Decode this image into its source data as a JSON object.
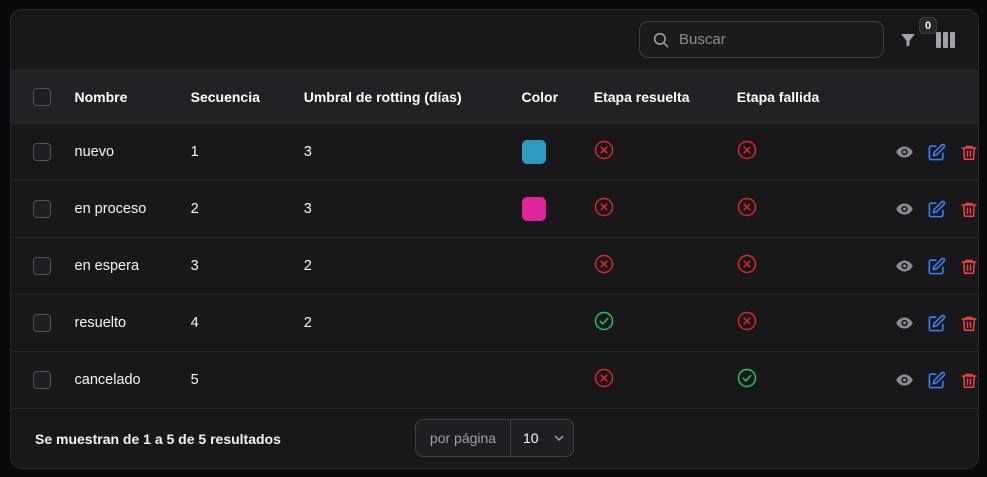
{
  "search": {
    "placeholder": "Buscar",
    "value": ""
  },
  "filters": {
    "count": "0"
  },
  "icons": {
    "search": "search-icon",
    "filter": "funnel-icon",
    "columns": "columns-icon",
    "view": "eye-icon",
    "edit": "pencil-square-icon",
    "delete": "trash-icon",
    "resolved_yes": "check-circle-icon",
    "resolved_no": "x-circle-icon"
  },
  "colors": {
    "edit": "#3b82f6",
    "delete": "#ef4444",
    "view": "#8b8b93",
    "success": "#22c55e",
    "danger": "#dc2626"
  },
  "table": {
    "headers": {
      "name": "Nombre",
      "sequence": "Secuencia",
      "threshold": "Umbral de rotting (días)",
      "color": "Color",
      "resolved": "Etapa resuelta",
      "failed": "Etapa fallida"
    },
    "rows": [
      {
        "name": "nuevo",
        "sequence": "1",
        "threshold": "3",
        "color": "#2d9cc0",
        "resolved": false,
        "failed": false
      },
      {
        "name": "en proceso",
        "sequence": "2",
        "threshold": "3",
        "color": "#e0249a",
        "resolved": false,
        "failed": false
      },
      {
        "name": "en espera",
        "sequence": "3",
        "threshold": "2",
        "color": "",
        "resolved": false,
        "failed": false
      },
      {
        "name": "resuelto",
        "sequence": "4",
        "threshold": "2",
        "color": "",
        "resolved": true,
        "failed": false
      },
      {
        "name": "cancelado",
        "sequence": "5",
        "threshold": "",
        "color": "",
        "resolved": false,
        "failed": true
      }
    ]
  },
  "footer": {
    "results": "Se muestran de 1 a 5 de 5 resultados",
    "per_page_label": "por página",
    "per_page_value": "10"
  }
}
